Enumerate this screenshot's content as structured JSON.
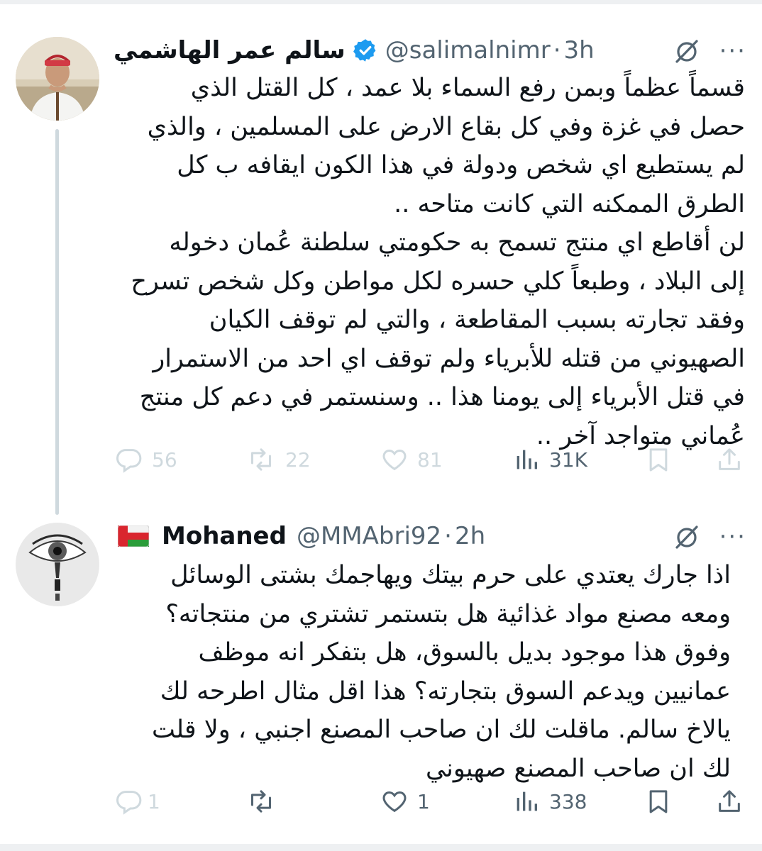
{
  "tweets": [
    {
      "display_name": "سالم عمر الهاشمي",
      "handle": "@salimalnimr",
      "time": "3h",
      "text": "قسماً عظماً وبمن رفع السماء بلا عمد ، كل القتل الذي\nحصل في غزة وفي كل بقاع الارض على المسلمين  ، والذي\nلم يستطيع اي شخص ودولة في هذا الكون ايقافه ب كل\nالطرق الممكنه التي كانت متاحه  ..\nلن أقاطع اي منتج تسمح به حكومتي سلطنة عُمان دخوله\nإلى البلاد ، وطبعاً كلي حسره لكل مواطن وكل شخص تسرح\nوفقد تجارته بسبب المقاطعة ، والتي لم توقف الكيان\nالصهيوني من قتله للأبرياء ولم توقف اي احد من الاستمرار\nفي قتل الأبرياء إلى يومنا هذا .. وسنستمر في دعم كل منتج\nعُماني متواجد آخر ..",
      "replies": "56",
      "reposts": "22",
      "likes": "81",
      "views": "31K"
    },
    {
      "display_name": "Mohaned",
      "handle": "@MMAbri92",
      "time": "2h",
      "text": "اذا جارك يعتدي على حرم بيتك ويهاجمك بشتى الوسائل\nومعه مصنع مواد غذائية هل بتستمر تشتري من منتجاته؟\nوفوق هذا موجود بديل بالسوق، هل بتفكر انه موظف\nعمانيين ويدعم السوق بتجارته؟ هذا اقل مثال اطرحه لك\nيالاخ سالم. ماقلت لك ان صاحب المصنع اجنبي ، ولا قلت\nلك ان صاحب المصنع صهيوني",
      "replies": "1",
      "reposts": "",
      "likes": "1",
      "views": "338"
    }
  ],
  "icons": {
    "verified": "verified-badge-icon",
    "grok": "grok-icon",
    "more": "more-icon",
    "flag": "oman-flag-icon"
  },
  "more_glyph": "···",
  "colors": {
    "accent": "#1d9bf0",
    "secondary_text": "#536471",
    "disabled_icon": "#cfd9de",
    "thread_line": "#cfd9de"
  }
}
